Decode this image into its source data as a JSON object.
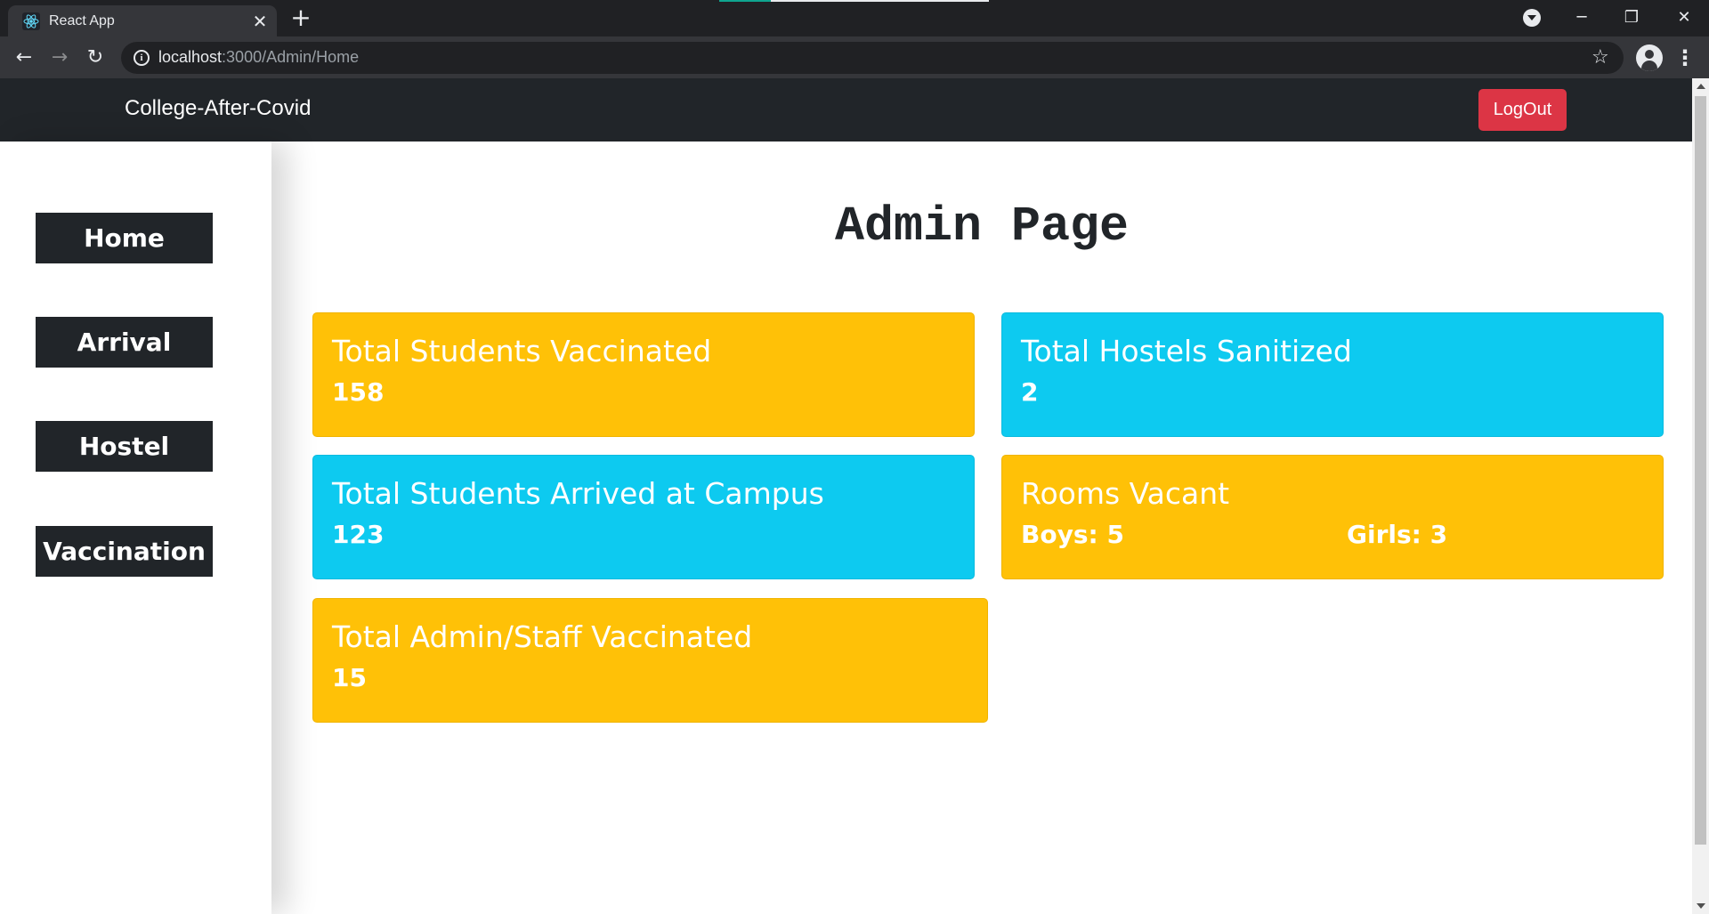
{
  "browser": {
    "tab_title": "React App",
    "url_host": "localhost",
    "url_rest": ":3000/Admin/Home"
  },
  "navbar": {
    "brand": "College-After-Covid",
    "logout_label": "LogOut"
  },
  "sidebar": {
    "items": [
      {
        "label": "Home"
      },
      {
        "label": "Arrival"
      },
      {
        "label": "Hostel"
      },
      {
        "label": "Vaccination"
      }
    ]
  },
  "main": {
    "title": "Admin Page",
    "cards": [
      {
        "title": "Total Students Vaccinated",
        "value": "158",
        "color": "#ffc107"
      },
      {
        "title": "Total Hostels Sanitized",
        "value": "2",
        "color": "#0dcaf0"
      },
      {
        "title": "Total Students Arrived at Campus",
        "value": "123",
        "color": "#0dcaf0"
      },
      {
        "title": "Rooms Vacant",
        "boys": "Boys: 5",
        "girls": "Girls: 3",
        "color": "#ffc107"
      },
      {
        "title": "Total Admin/Staff Vaccinated",
        "value": "15",
        "color": "#ffc107"
      }
    ]
  },
  "colors": {
    "navbar_bg": "#212529",
    "logout_bg": "#dc3545",
    "warning": "#ffc107",
    "info": "#0dcaf0"
  },
  "icons": [
    "react-icon",
    "close-icon",
    "plus-icon",
    "tab-search-icon",
    "minimize-icon",
    "restore-icon",
    "window-close-icon",
    "back-arrow-icon",
    "forward-arrow-icon",
    "reload-icon",
    "info-icon",
    "star-icon",
    "profile-icon",
    "kebab-menu-icon"
  ]
}
